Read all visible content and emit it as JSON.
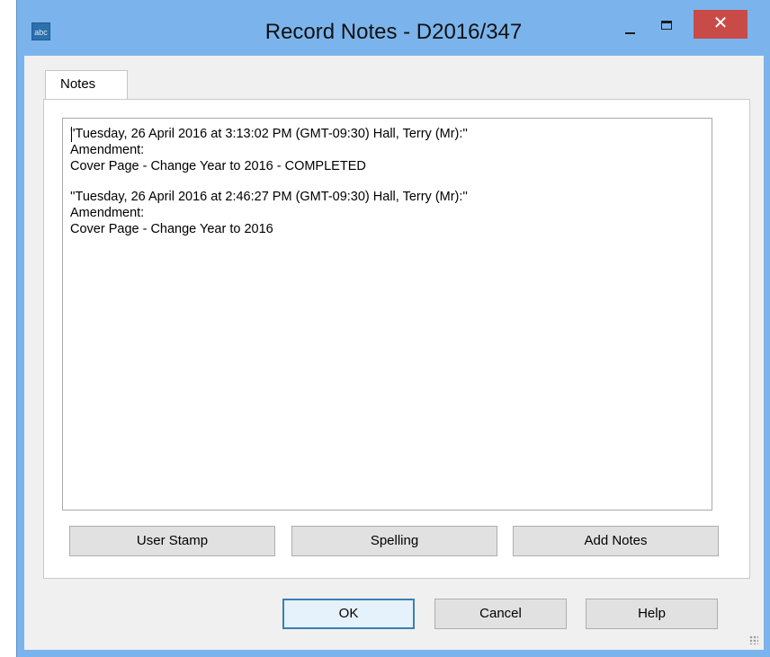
{
  "window": {
    "title": "Record Notes - D2016/347",
    "app_icon_text": "abc",
    "minimize_icon": "minimize-icon",
    "maximize_icon": "maximize-icon",
    "close_icon": "close-icon",
    "close_glyph": "✕",
    "accent_color": "#7bb4ec",
    "close_color": "#c94b48"
  },
  "tabs": [
    {
      "label": "Notes",
      "selected": true
    }
  ],
  "notes": [
    {
      "header": "''Tuesday, 26 April 2016 at 3:13:02 PM (GMT-09:30)   Hall, Terry (Mr):''",
      "lines": [
        "Amendment:",
        "Cover Page - Change Year to 2016 - COMPLETED"
      ]
    },
    {
      "header": "''Tuesday, 26 April 2016 at 2:46:27 PM (GMT-09:30)   Hall, Terry (Mr):''",
      "lines": [
        "Amendment:",
        "Cover Page - Change Year to 2016"
      ]
    }
  ],
  "panel_buttons": {
    "user_stamp": "User Stamp",
    "spelling": "Spelling",
    "add_notes": "Add Notes"
  },
  "dialog_buttons": {
    "ok": "OK",
    "cancel": "Cancel",
    "help": "Help"
  }
}
